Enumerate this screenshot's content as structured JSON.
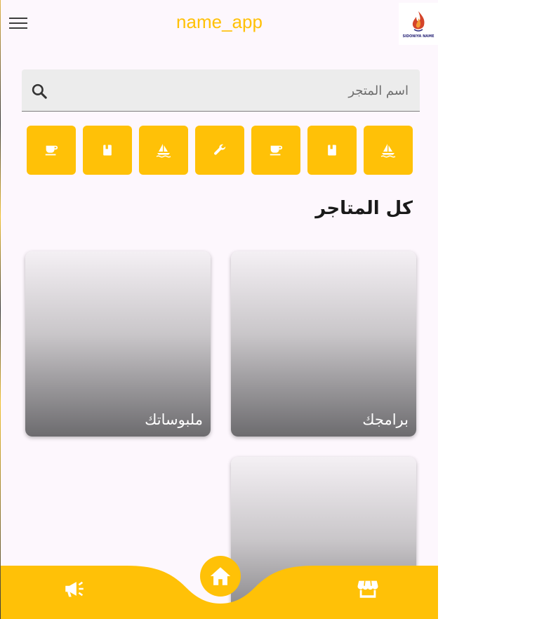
{
  "header": {
    "title": "name_app",
    "logo_text": "SIDONIYA NAME"
  },
  "search": {
    "placeholder": "اسم المتجر",
    "value": ""
  },
  "categories": [
    {
      "icon": "coffee-icon"
    },
    {
      "icon": "book-icon"
    },
    {
      "icon": "sailboat-icon"
    },
    {
      "icon": "wrench-icon"
    },
    {
      "icon": "coffee-icon"
    },
    {
      "icon": "book-icon"
    },
    {
      "icon": "sailboat-icon"
    }
  ],
  "section": {
    "title": "كل المتاجر"
  },
  "stores": [
    {
      "label": "برامجك"
    },
    {
      "label": "ملبوساتك"
    },
    {
      "label": ""
    }
  ],
  "bottom_nav": {
    "left_icon": "megaphone-icon",
    "center_icon": "home-icon",
    "right_icon": "storefront-icon"
  },
  "colors": {
    "accent": "#ffc107",
    "background": "#fdf7fd",
    "search_bg": "#ececec"
  }
}
